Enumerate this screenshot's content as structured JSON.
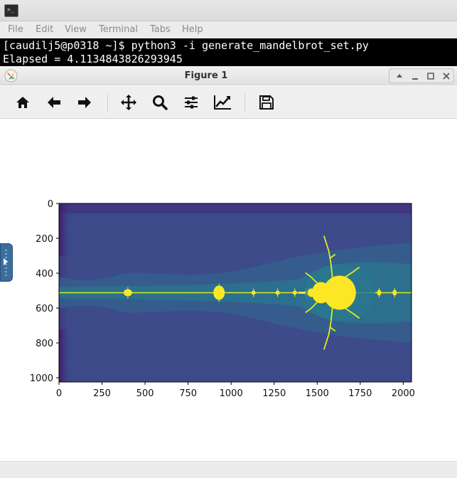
{
  "terminal": {
    "menu": [
      "File",
      "Edit",
      "View",
      "Terminal",
      "Tabs",
      "Help"
    ],
    "lines": [
      "[caudilj5@p0318 ~]$ python3 -i generate_mandelbrot_set.py",
      "Elapsed = 4.1134843826293945"
    ]
  },
  "figure": {
    "title": "Figure 1",
    "toolbar": [
      "home-icon",
      "back-arrow-icon",
      "forward-arrow-icon",
      "pan-icon",
      "zoom-icon",
      "configure-subplots-icon",
      "edit-axis-icon",
      "save-icon"
    ]
  },
  "chart_data": {
    "type": "heatmap",
    "title": "",
    "xlabel": "",
    "ylabel": "",
    "xlim": [
      0,
      2048
    ],
    "ylim": [
      1024,
      0
    ],
    "x_ticks": [
      0,
      250,
      500,
      750,
      1000,
      1250,
      1500,
      1750,
      2000
    ],
    "y_ticks": [
      0,
      200,
      400,
      600,
      800,
      1000
    ],
    "colormap": "viridis",
    "colors": {
      "background": "#3d4a8a",
      "deep": "#45166d",
      "band1": "#3e4c8a",
      "band2": "#33628d",
      "band3": "#2a788e",
      "set": "#fde725",
      "filament": "#dcee1e"
    },
    "image_width": 2048,
    "image_height": 1024
  }
}
